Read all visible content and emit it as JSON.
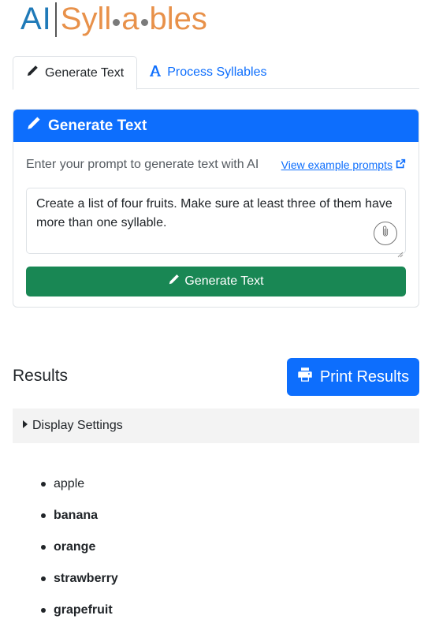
{
  "logo": {
    "ai": "AI",
    "syllables_parts": [
      "Syll",
      "a",
      "bles"
    ]
  },
  "tabs": [
    {
      "label": "Generate Text",
      "icon": "pencil-icon",
      "active": true
    },
    {
      "label": "Process Syllables",
      "icon": "font-a-icon",
      "active": false
    }
  ],
  "card": {
    "header_title": "Generate Text",
    "prompt_label": "Enter your prompt to generate text with AI",
    "example_link": "View example prompts",
    "prompt_value": "Create a list of four fruits.  Make sure at least three of them have more than one syllable.",
    "generate_button": "Generate Text"
  },
  "results": {
    "title": "Results",
    "print_button": "Print Results",
    "display_settings": "Display Settings",
    "items": [
      {
        "text": "apple",
        "bold": false
      },
      {
        "text": "banana",
        "bold": true
      },
      {
        "text": "orange",
        "bold": true
      },
      {
        "text": "strawberry",
        "bold": true
      },
      {
        "text": "grapefruit",
        "bold": true
      }
    ]
  },
  "colors": {
    "primary": "#0d6efd",
    "success": "#198754",
    "logo_blue": "#1f7ab8",
    "logo_orange": "#e8914a"
  }
}
